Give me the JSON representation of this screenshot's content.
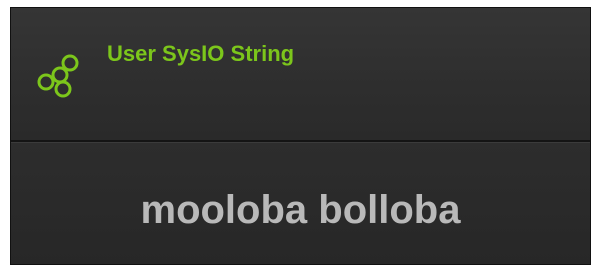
{
  "widget": {
    "icon": "cluster-nodes-icon",
    "title": "User SysIO String",
    "value": "mooloba bolloba"
  },
  "colors": {
    "accent": "#7cc61b",
    "value_text": "#b9b9b9",
    "panel_background": "#2c2c2c"
  }
}
